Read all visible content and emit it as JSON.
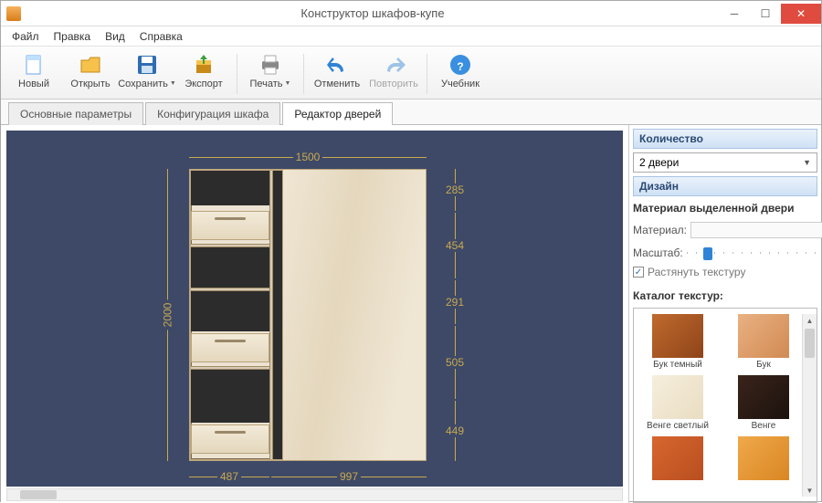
{
  "window": {
    "title": "Конструктор шкафов-купе"
  },
  "menu": {
    "file": "Файл",
    "edit": "Правка",
    "view": "Вид",
    "help": "Справка"
  },
  "toolbar": {
    "new": "Новый",
    "open": "Открыть",
    "save": "Сохранить",
    "export": "Экспорт",
    "print": "Печать",
    "undo": "Отменить",
    "redo": "Повторить",
    "tutorial": "Учебник"
  },
  "tabs": {
    "params": "Основные параметры",
    "config": "Конфигурация шкафа",
    "doors": "Редактор дверей"
  },
  "dimensions": {
    "total_width": "1500",
    "total_height": "2000",
    "col1_width": "487",
    "col2_width": "997",
    "rows": [
      "285",
      "454",
      "291",
      "505",
      "449"
    ]
  },
  "side": {
    "count_head": "Количество",
    "count_value": "2 двери",
    "design_head": "Дизайн",
    "material_section": "Материал выделенной двери",
    "material_label": "Материал:",
    "scale_label": "Масштаб:",
    "stretch_label": "Растянуть текстуру",
    "catalog_label": "Каталог текстур:",
    "textures": [
      {
        "name": "Бук темный",
        "color": "linear-gradient(135deg,#c06a2e,#8e4418)"
      },
      {
        "name": "Бук",
        "color": "linear-gradient(135deg,#e9b182,#d18a53)"
      },
      {
        "name": "Венге светлый",
        "color": "linear-gradient(135deg,#f6eedd,#e9ddc2)"
      },
      {
        "name": "Венге",
        "color": "linear-gradient(135deg,#3a241b,#1c120d)"
      },
      {
        "name": "",
        "color": "linear-gradient(135deg,#d8662f,#b84f1f)"
      },
      {
        "name": "",
        "color": "linear-gradient(135deg,#f0a94a,#d98623)"
      }
    ]
  }
}
